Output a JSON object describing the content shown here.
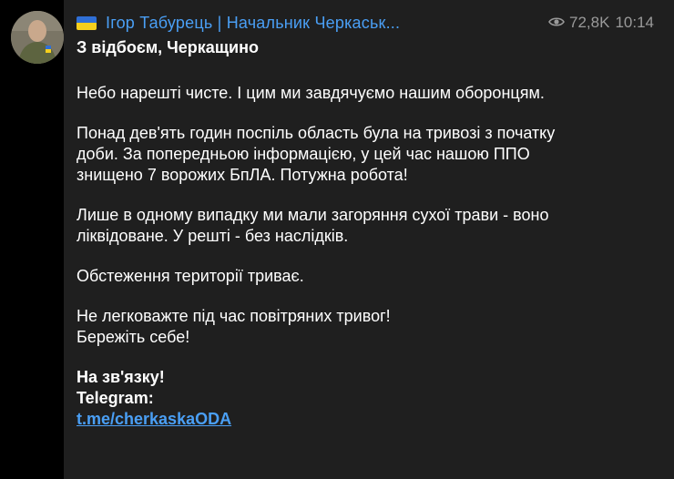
{
  "post": {
    "channel_title": "Ігор Табурець | Начальник Черкаськ...",
    "views": "72,8K",
    "time": "10:14",
    "title": "З відбоєм, Черкащино",
    "paragraphs": [
      "Небо нарешті чисте. І цим ми завдячуємо нашим оборонцям.",
      "Понад дев'ять годин поспіль область була на тривозі з початку доби. За попередньою інформацією, у цей час нашою ППО знищено 7 ворожих БпЛА. Потужна робота!",
      "Лише в одному випадку ми мали загоряння сухої трави - воно ліквідоване. У решті - без наслідків.",
      "Обстеження території триває.",
      "Не легковажте під час повітряних тривог! Бережіть себе!"
    ],
    "footer_heading": "На зв'язку!",
    "telegram_label": "Telegram:",
    "link_text": "t.me/cherkaskaODA"
  },
  "icons": {
    "views": "eye-icon",
    "share": "share-arrow-icon",
    "flag": "ukraine-flag-icon"
  },
  "colors": {
    "background": "#000000",
    "bubble": "#1f1f1f",
    "accent": "#4a9ff5",
    "text": "#ffffff",
    "meta": "#9a9a9a",
    "flag_blue": "#2f6fd6",
    "flag_yellow": "#f5cf1d"
  }
}
